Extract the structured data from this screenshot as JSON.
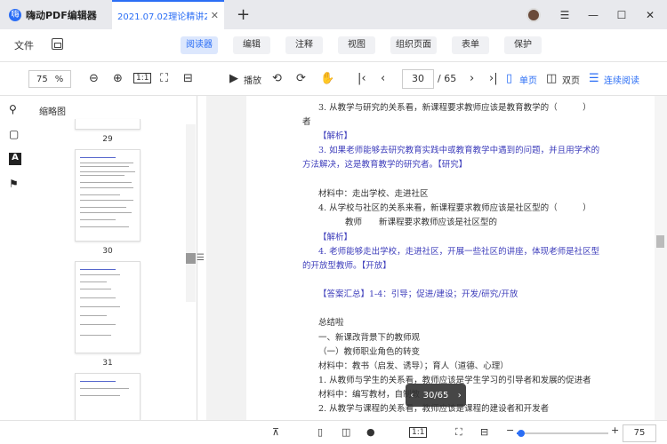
{
  "app": {
    "name": "嗨动PDF编辑器",
    "logo": "嗨"
  },
  "tab": {
    "title": "2021.07.02理论精讲2-...",
    "close": "✕"
  },
  "titlebar": {
    "add_tab": "+",
    "min": "—",
    "max": "☐",
    "close": "✕",
    "menu": "☰"
  },
  "menubar": {
    "file": "文件",
    "items": [
      "阅读器",
      "编辑",
      "注释",
      "视图",
      "组织页面",
      "表单",
      "保护"
    ]
  },
  "toolbar": {
    "zoom": "75",
    "zoom_unit": "%",
    "play": "播放",
    "page": "30",
    "total": "/ 65",
    "single": "单页",
    "double": "双页",
    "continuous": "连续阅读"
  },
  "thumbnails": {
    "title": "缩略图",
    "pages": [
      "29",
      "30",
      "31"
    ]
  },
  "doc_lines": [
    "3. 从教学与研究的关系看，新课程要求教师应该是教育教学的（　　　）",
    "者",
    "【解析】",
    "3. 如果老师能够去研究教育实践中或教育教学中遇到的问题，并且用学术的",
    "方法解决，这是教育教学的研究者。【研究】",
    "材料中：走出学校、走进社区",
    "4. 从学校与社区的关系来看，新课程要求教师应该是社区型的（　　　）",
    "教师　　新课程要求教师应该是社区型的",
    "【解析】",
    "4. 老师能够走出学校，走进社区，开展一些社区的讲座，体现老师是社区型",
    "的开放型教师。【开放】",
    "【答案汇总】1-4：引导；促进/建设；开发/研究/开放",
    "总结啦",
    "一、新课改背景下的教师观",
    "（一）教师职业角色的转变",
    "材料中：教书（启发、诱导）；育人（道德、心理）",
    "1. 从教师与学生的关系看，教师应该是学生学习的引导者和发展的促进者",
    "材料中：编写教材，自制教",
    "2. 从教学与课程的关系看，教师应该是课程的建设者和开发者"
  ],
  "pager": {
    "text": "30/65",
    "prev": "‹",
    "next": "›"
  },
  "bottombar": {
    "fit": "1:1",
    "zoom": "75",
    "minus": "−",
    "plus": "+",
    "zoom_fraction": 0.05
  }
}
